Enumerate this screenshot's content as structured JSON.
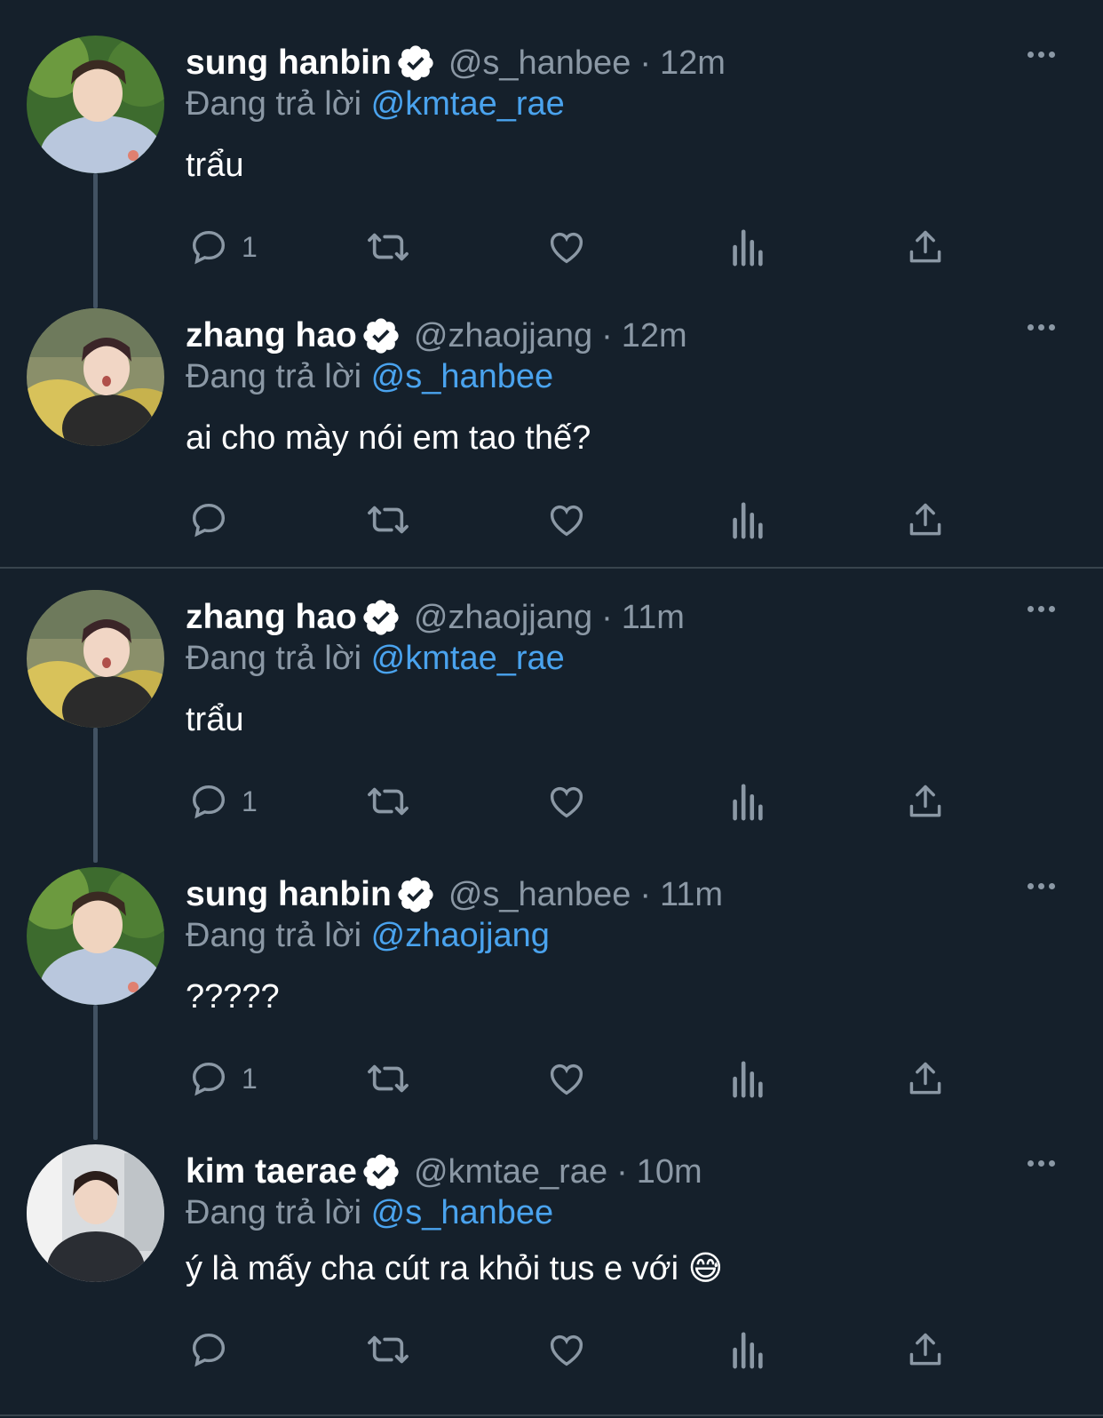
{
  "reply_prefix": "Đang trả lời",
  "dot_separator": "·",
  "tweets": [
    {
      "name": "sung hanbin",
      "handle": "@s_hanbee",
      "time": "12m",
      "reply_to": "@kmtae_rae",
      "text": "trẩu",
      "reply_count": "1"
    },
    {
      "name": "zhang hao",
      "handle": "@zhaojjang",
      "time": "12m",
      "reply_to": "@s_hanbee",
      "text": "ai cho mày nói em tao thế?",
      "reply_count": ""
    },
    {
      "name": "zhang hao",
      "handle": "@zhaojjang",
      "time": "11m",
      "reply_to": "@kmtae_rae",
      "text": "trẩu",
      "reply_count": "1"
    },
    {
      "name": "sung hanbin",
      "handle": "@s_hanbee",
      "time": "11m",
      "reply_to": "@zhaojjang",
      "text": "?????",
      "reply_count": "1"
    },
    {
      "name": "kim taerae",
      "handle": "@kmtae_rae",
      "time": "10m",
      "reply_to": "@s_hanbee",
      "text": "ý là mấy cha cút ra khỏi tus e với 😅",
      "reply_count": ""
    }
  ],
  "colors": {
    "background": "#15202b",
    "secondary_text": "#8b98a5",
    "mention": "#4aa3ee",
    "verified_badge": "#ffffff"
  },
  "icons": [
    "verified-badge-icon",
    "more-options-icon",
    "reply-icon",
    "retweet-icon",
    "like-icon",
    "views-icon",
    "share-icon"
  ]
}
